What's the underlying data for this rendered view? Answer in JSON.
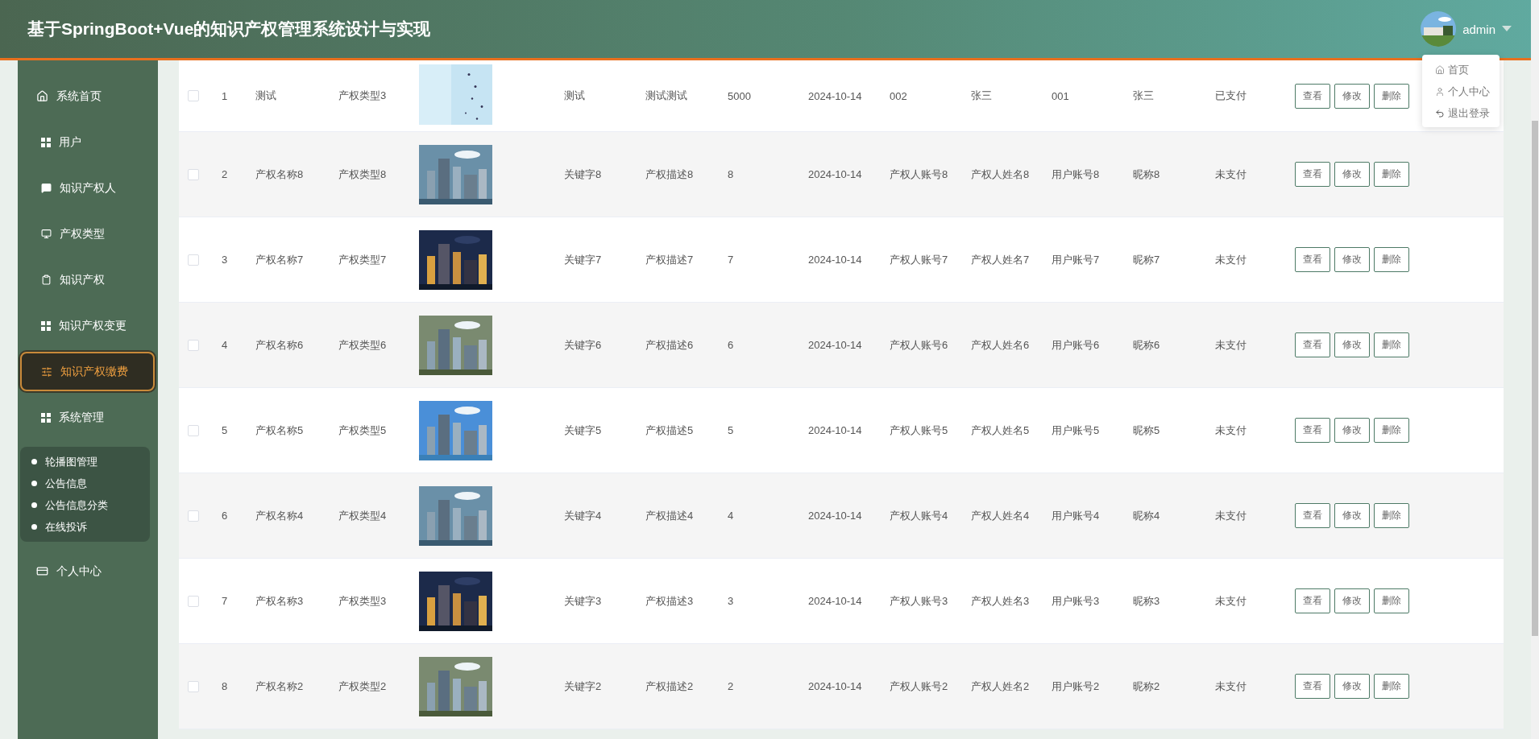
{
  "header": {
    "title": "基于SpringBoot+Vue的知识产权管理系统设计与实现",
    "user": "admin"
  },
  "user_menu": [
    {
      "label": "首页"
    },
    {
      "label": "个人中心"
    },
    {
      "label": "退出登录"
    }
  ],
  "sidebar": {
    "items": [
      {
        "label": "系统首页",
        "kind": "link",
        "selected": false
      },
      {
        "label": "用户",
        "kind": "menu",
        "selected": false
      },
      {
        "label": "知识产权人",
        "kind": "menu",
        "selected": false
      },
      {
        "label": "产权类型",
        "kind": "menu",
        "selected": false
      },
      {
        "label": "知识产权",
        "kind": "menu",
        "selected": false
      },
      {
        "label": "知识产权变更",
        "kind": "menu",
        "selected": false
      },
      {
        "label": "知识产权缴费",
        "kind": "menu",
        "selected": true
      },
      {
        "label": "系统管理",
        "kind": "menu",
        "selected": false,
        "children": [
          {
            "label": "轮播图管理"
          },
          {
            "label": "公告信息"
          },
          {
            "label": "公告信息分类"
          },
          {
            "label": "在线投诉"
          }
        ]
      },
      {
        "label": "个人中心",
        "kind": "link",
        "selected": false
      }
    ]
  },
  "table": {
    "rows": [
      {
        "checked": false,
        "index": "1",
        "name": "测试",
        "type": "产权类型3",
        "image": {
          "kind": "picture"
        },
        "keyword": "测试",
        "description": "测试测试",
        "amount": "5000",
        "date": "2024-10-14",
        "owner_account": "002",
        "owner_name": "张三",
        "user_account": "001",
        "nickname": "张三",
        "status": "已支付",
        "actions": [
          "查看",
          "修改",
          "删除"
        ]
      },
      {
        "checked": false,
        "index": "2",
        "name": "产权名称8",
        "type": "产权类型8",
        "image": {
          "kind": "picture"
        },
        "keyword": "关键字8",
        "description": "产权描述8",
        "amount": "8",
        "date": "2024-10-14",
        "owner_account": "产权人账号8",
        "owner_name": "产权人姓名8",
        "user_account": "用户账号8",
        "nickname": "昵称8",
        "status": "未支付",
        "actions": [
          "查看",
          "修改",
          "删除"
        ]
      },
      {
        "checked": false,
        "index": "3",
        "name": "产权名称7",
        "type": "产权类型7",
        "image": {
          "kind": "picture"
        },
        "keyword": "关键字7",
        "description": "产权描述7",
        "amount": "7",
        "date": "2024-10-14",
        "owner_account": "产权人账号7",
        "owner_name": "产权人姓名7",
        "user_account": "用户账号7",
        "nickname": "昵称7",
        "status": "未支付",
        "actions": [
          "查看",
          "修改",
          "删除"
        ]
      },
      {
        "checked": false,
        "index": "4",
        "name": "产权名称6",
        "type": "产权类型6",
        "image": {
          "kind": "picture"
        },
        "keyword": "关键字6",
        "description": "产权描述6",
        "amount": "6",
        "date": "2024-10-14",
        "owner_account": "产权人账号6",
        "owner_name": "产权人姓名6",
        "user_account": "用户账号6",
        "nickname": "昵称6",
        "status": "未支付",
        "actions": [
          "查看",
          "修改",
          "删除"
        ]
      },
      {
        "checked": false,
        "index": "5",
        "name": "产权名称5",
        "type": "产权类型5",
        "image": {
          "kind": "picture"
        },
        "keyword": "关键字5",
        "description": "产权描述5",
        "amount": "5",
        "date": "2024-10-14",
        "owner_account": "产权人账号5",
        "owner_name": "产权人姓名5",
        "user_account": "用户账号5",
        "nickname": "昵称5",
        "status": "未支付",
        "actions": [
          "查看",
          "修改",
          "删除"
        ]
      },
      {
        "checked": false,
        "index": "6",
        "name": "产权名称4",
        "type": "产权类型4",
        "image": {
          "kind": "picture"
        },
        "keyword": "关键字4",
        "description": "产权描述4",
        "amount": "4",
        "date": "2024-10-14",
        "owner_account": "产权人账号4",
        "owner_name": "产权人姓名4",
        "user_account": "用户账号4",
        "nickname": "昵称4",
        "status": "未支付",
        "actions": [
          "查看",
          "修改",
          "删除"
        ]
      },
      {
        "checked": false,
        "index": "7",
        "name": "产权名称3",
        "type": "产权类型3",
        "image": {
          "kind": "picture"
        },
        "keyword": "关键字3",
        "description": "产权描述3",
        "amount": "3",
        "date": "2024-10-14",
        "owner_account": "产权人账号3",
        "owner_name": "产权人姓名3",
        "user_account": "用户账号3",
        "nickname": "昵称3",
        "status": "未支付",
        "actions": [
          "查看",
          "修改",
          "删除"
        ]
      },
      {
        "checked": false,
        "index": "8",
        "name": "产权名称2",
        "type": "产权类型2",
        "image": {
          "kind": "picture"
        },
        "keyword": "关键字2",
        "description": "产权描述2",
        "amount": "2",
        "date": "2024-10-14",
        "owner_account": "产权人账号2",
        "owner_name": "产权人姓名2",
        "user_account": "用户账号2",
        "nickname": "昵称2",
        "status": "未支付",
        "actions": [
          "查看",
          "修改",
          "删除"
        ]
      }
    ]
  }
}
